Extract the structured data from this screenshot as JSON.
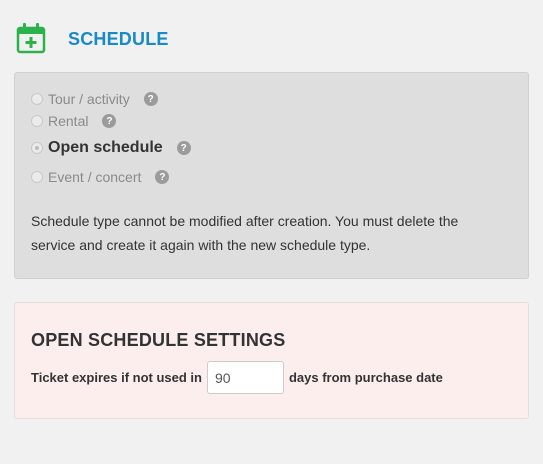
{
  "header": {
    "title": "SCHEDULE",
    "icon": "calendar-plus-icon",
    "accent": "#1a8ac6",
    "icon_color": "#2bb24c"
  },
  "schedule_type": {
    "options": [
      {
        "label": "Tour / activity",
        "help": "?"
      },
      {
        "label": "Rental",
        "help": "?"
      },
      {
        "label": "Open schedule",
        "help": "?",
        "selected": true
      },
      {
        "label": "Event / concert",
        "help": "?"
      }
    ],
    "note": "Schedule type cannot be modified after creation. You must delete the service and create it again with the new schedule type."
  },
  "open_schedule_settings": {
    "title": "OPEN SCHEDULE SETTINGS",
    "expire_prefix": "Ticket expires if not used in",
    "expire_days": "90",
    "expire_suffix": "days from purchase date",
    "panel_color": "#fdeeee"
  }
}
